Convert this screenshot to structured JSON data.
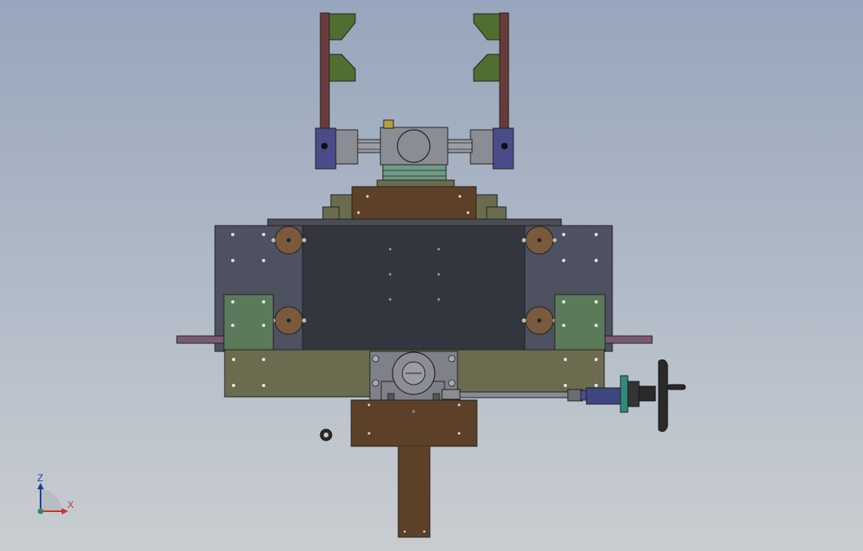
{
  "colors": {
    "background_top": "#97a6bc",
    "background_bottom": "#c9cdd1",
    "frame_dark": "#3a3d45",
    "plate_olive": "#6b6c4f",
    "plate_green": "#5b7a5a",
    "plate_brown": "#5c4028",
    "roller_brown": "#7a5a3c",
    "clamp_red": "#6a3a3a",
    "pad_green": "#4f6e30",
    "block_purple": "#4a4c8a",
    "shaft_gray": "#8a8d94",
    "axis_x": "#c0392b",
    "axis_y": "#2e8b57",
    "axis_z": "#1f3b9a"
  },
  "triad": {
    "z_label": "Z",
    "x_label": "X"
  }
}
